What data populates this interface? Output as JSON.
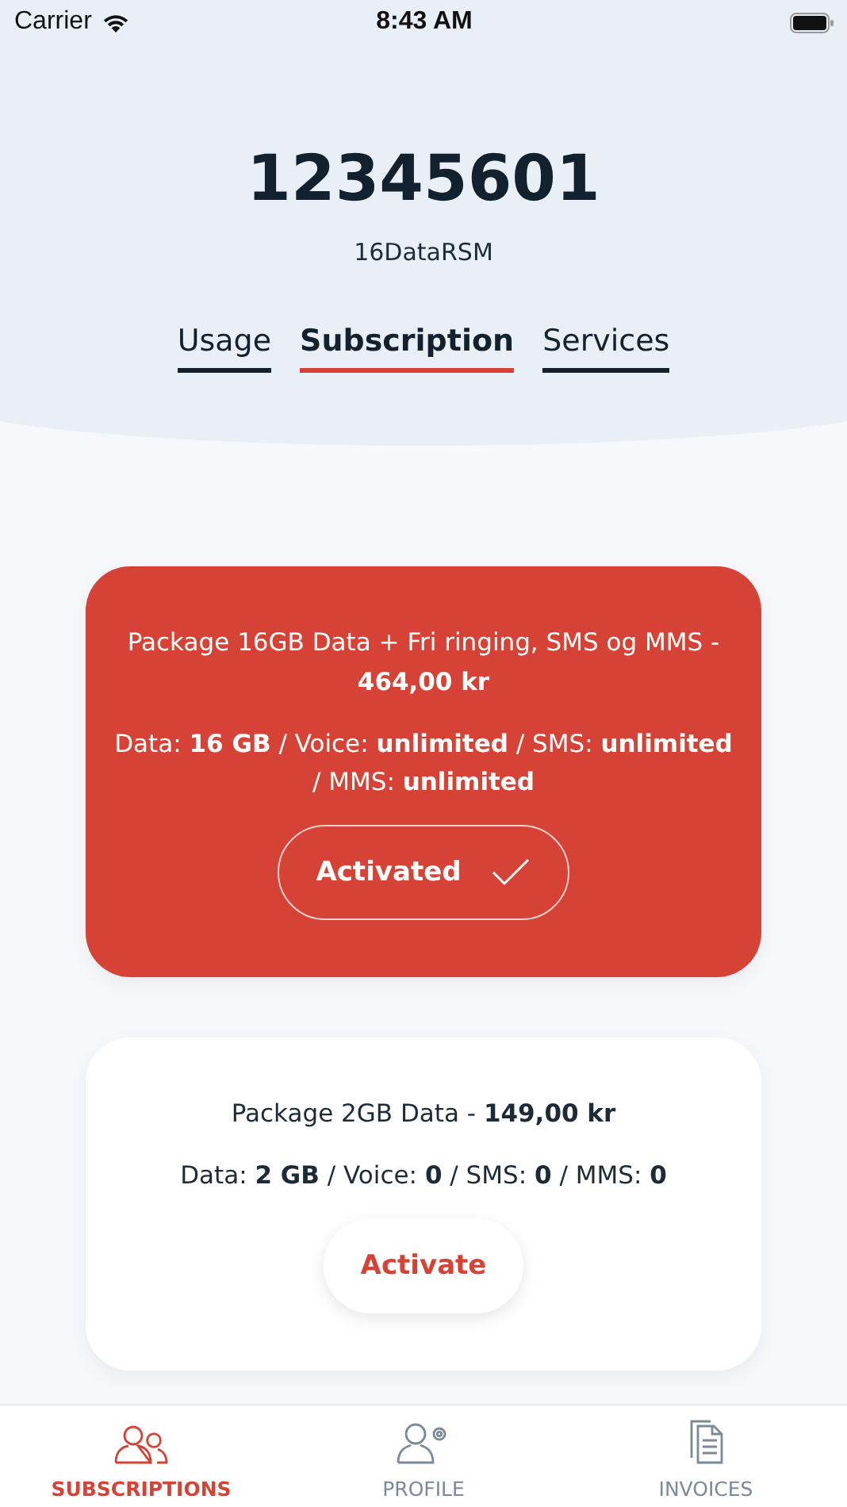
{
  "status_bar": {
    "carrier": "Carrier",
    "time": "8:43 AM"
  },
  "header": {
    "number": "12345601",
    "plan": "16DataRSM"
  },
  "tabs": [
    {
      "label": "Usage",
      "selected": false
    },
    {
      "label": "Subscription",
      "selected": true
    },
    {
      "label": "Services",
      "selected": false
    }
  ],
  "packages": [
    {
      "title": "Package 16GB Data + Fri ringing, SMS og MMS - **464,00 kr**",
      "details": "Data: **16 GB** / Voice: **unlimited** / SMS: **unlimited** / MMS: **unlimited**",
      "button": "Activated",
      "activated": true
    },
    {
      "title": "Package 2GB Data - **149,00 kr**",
      "details": "Data: **2 GB** / Voice: **0** / SMS: **0** / MMS: **0**",
      "button": "Activate",
      "activated": false
    }
  ],
  "bottom_nav": [
    {
      "label": "SUBSCRIPTIONS",
      "kind": "people",
      "selected": true
    },
    {
      "label": "PROFILE",
      "kind": "profile",
      "selected": false
    },
    {
      "label": "INVOICES",
      "kind": "invoices",
      "selected": false
    }
  ]
}
